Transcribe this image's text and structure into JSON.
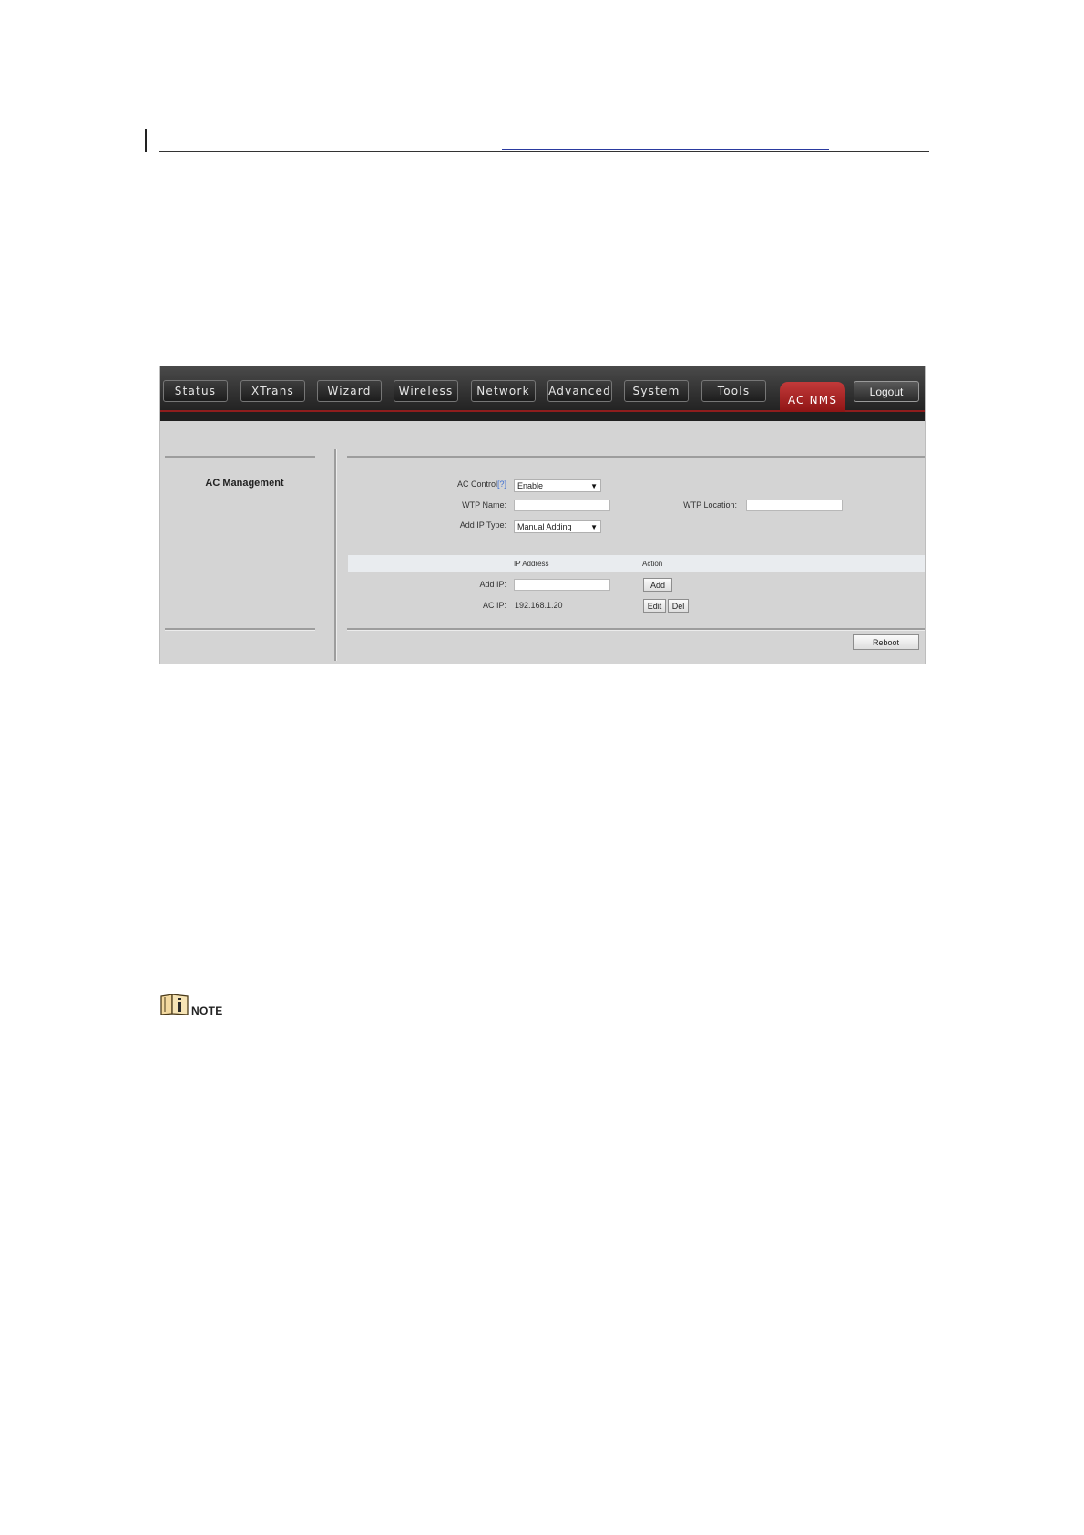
{
  "nav": {
    "tabs": [
      "Status",
      "XTrans",
      "Wizard",
      "Wireless",
      "Network",
      "Advanced",
      "System",
      "Tools"
    ],
    "active_tab": "AC NMS",
    "logout": "Logout"
  },
  "sidebar": {
    "title": "AC Management"
  },
  "form": {
    "ac_control_label": "AC Control",
    "ac_control_help": "[?]",
    "ac_control_value": "Enable",
    "wtp_name_label": "WTP Name:",
    "wtp_name_value": "",
    "wtp_location_label": "WTP Location:",
    "wtp_location_value": "",
    "add_ip_type_label": "Add IP Type:",
    "add_ip_type_value": "Manual Adding"
  },
  "table": {
    "headers": {
      "ip": "IP Address",
      "action": "Action"
    },
    "add_ip_label": "Add IP:",
    "add_ip_value": "",
    "add_button": "Add",
    "ac_ip_label": "AC IP:",
    "ac_ip_value": "192.168.1.20",
    "edit_button": "Edit",
    "del_button": "Del"
  },
  "reboot_button": "Reboot",
  "note": {
    "label": "NOTE"
  }
}
